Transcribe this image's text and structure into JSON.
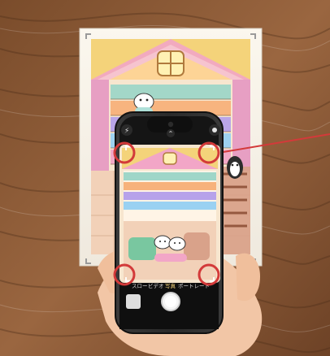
{
  "scene": {
    "description_type": "photo",
    "colors": {
      "wood": "#8a5a34",
      "wood_dark": "#5b3820",
      "paper": "#f7f3ea",
      "phone_body": "#2b2b2b",
      "phone_screen": "#111111",
      "accent_marker": "#d33a3a",
      "pink": "#f2a6c7",
      "yellow": "#f4d37a",
      "green": "#79c7a0",
      "blue": "#7bb8e6",
      "brown": "#c07a49",
      "skin": "#f2c6a6"
    }
  },
  "camera_ui": {
    "modes": [
      "スロー",
      "ビデオ",
      "写真",
      "ポートレート"
    ],
    "selected_mode": "写真"
  },
  "icons": {
    "flash": "flash-icon",
    "chevron": "chevron-up-icon",
    "live": "live-photo-icon",
    "shutter": "shutter-button-icon",
    "thumbnail": "thumbnail-icon",
    "flip": "flip-camera-icon"
  }
}
